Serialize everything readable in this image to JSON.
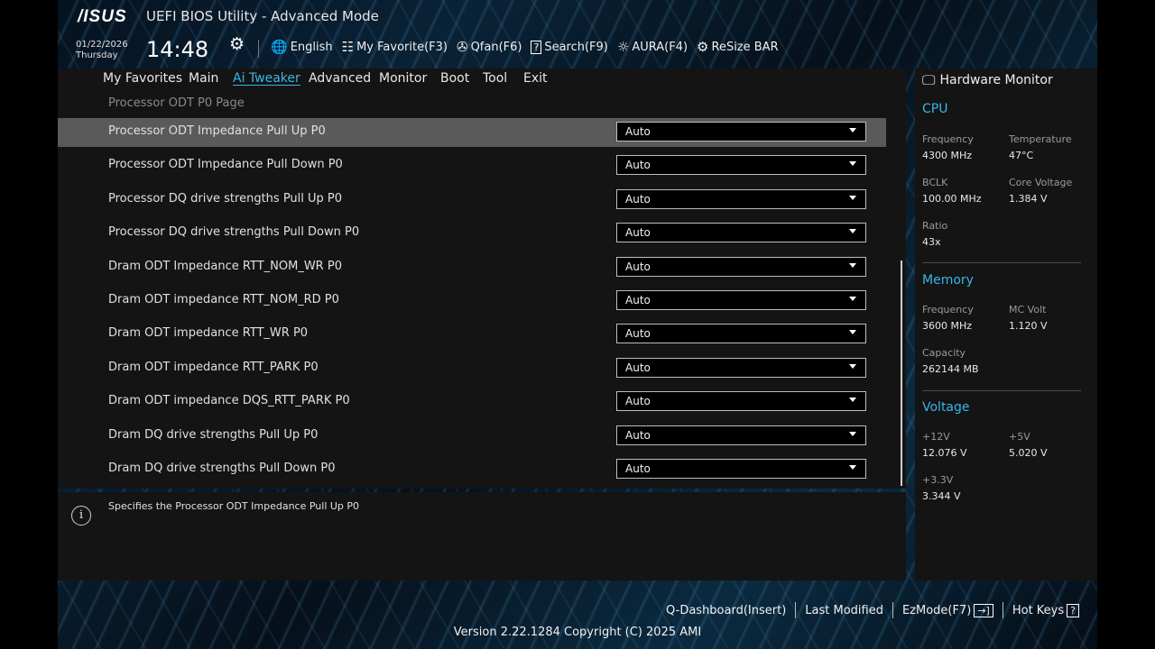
{
  "header": {
    "logo": "/ISUS",
    "title": "UEFI BIOS Utility - Advanced Mode",
    "date": "01/22/2026",
    "weekday": "Thursday",
    "time": "14:48"
  },
  "toolbar": [
    {
      "name": "language",
      "icon": "globe-icon",
      "glyph": "🌐",
      "label": "English"
    },
    {
      "name": "my-favorite",
      "icon": "list-icon",
      "glyph": "☷",
      "label": "My Favorite(F3)"
    },
    {
      "name": "qfan",
      "icon": "fan-icon",
      "glyph": "✇",
      "label": "Qfan(F6)"
    },
    {
      "name": "search",
      "icon": "search-icon",
      "glyph": "?",
      "label": "Search(F9)"
    },
    {
      "name": "aura",
      "icon": "aura-icon",
      "glyph": "☼",
      "label": "AURA(F4)"
    },
    {
      "name": "resize-bar",
      "icon": "resize-bar-icon",
      "glyph": "⚙",
      "label": "ReSize BAR"
    }
  ],
  "tabs": [
    {
      "label": "My Favorites",
      "active": false
    },
    {
      "label": "Main",
      "active": false
    },
    {
      "label": "Ai Tweaker",
      "active": true
    },
    {
      "label": "Advanced",
      "active": false
    },
    {
      "label": "Monitor",
      "active": false
    },
    {
      "label": "Boot",
      "active": false
    },
    {
      "label": "Tool",
      "active": false
    },
    {
      "label": "Exit",
      "active": false
    }
  ],
  "panel": {
    "page_label": "Processor ODT P0 Page",
    "rows": [
      {
        "label": "Processor ODT Impedance Pull Up P0",
        "value": "Auto",
        "selected": true
      },
      {
        "label": "Processor ODT Impedance Pull Down P0",
        "value": "Auto",
        "selected": false
      },
      {
        "label": "Processor DQ drive strengths Pull Up P0",
        "value": "Auto",
        "selected": false
      },
      {
        "label": "Processor DQ drive strengths Pull Down P0",
        "value": "Auto",
        "selected": false
      },
      {
        "label": "Dram ODT Impedance RTT_NOM_WR P0",
        "value": "Auto",
        "selected": false
      },
      {
        "label": "Dram ODT impedance RTT_NOM_RD P0",
        "value": "Auto",
        "selected": false
      },
      {
        "label": "Dram ODT impedance RTT_WR P0",
        "value": "Auto",
        "selected": false
      },
      {
        "label": "Dram ODT impedance RTT_PARK P0",
        "value": "Auto",
        "selected": false
      },
      {
        "label": "Dram ODT impedance DQS_RTT_PARK P0",
        "value": "Auto",
        "selected": false
      },
      {
        "label": "Dram DQ drive strengths Pull Up P0",
        "value": "Auto",
        "selected": false
      },
      {
        "label": "Dram DQ drive strengths Pull Down P0",
        "value": "Auto",
        "selected": false
      }
    ]
  },
  "help": {
    "icon": "info-icon",
    "text": "Specifies the Processor ODT Impedance Pull Up P0"
  },
  "hw": {
    "title": "Hardware Monitor",
    "cpu": {
      "title": "CPU",
      "frequency_label": "Frequency",
      "frequency": "4300 MHz",
      "temperature_label": "Temperature",
      "temperature": "47°C",
      "bclk_label": "BCLK",
      "bclk": "100.00 MHz",
      "core_voltage_label": "Core Voltage",
      "core_voltage": "1.384 V",
      "ratio_label": "Ratio",
      "ratio": "43x"
    },
    "memory": {
      "title": "Memory",
      "frequency_label": "Frequency",
      "frequency": "3600 MHz",
      "mc_volt_label": "MC Volt",
      "mc_volt": "1.120 V",
      "capacity_label": "Capacity",
      "capacity": "262144 MB"
    },
    "voltage": {
      "title": "Voltage",
      "v12_label": "+12V",
      "v12": "12.076 V",
      "v5_label": "+5V",
      "v5": "5.020 V",
      "v33_label": "+3.3V",
      "v33": "3.344 V"
    }
  },
  "footer": {
    "q_dashboard": "Q-Dashboard(Insert)",
    "last_modified": "Last Modified",
    "ezmode": "EzMode(F7)",
    "hot_keys": "Hot Keys",
    "version": "Version 2.22.1284 Copyright (C) 2025 AMI"
  }
}
